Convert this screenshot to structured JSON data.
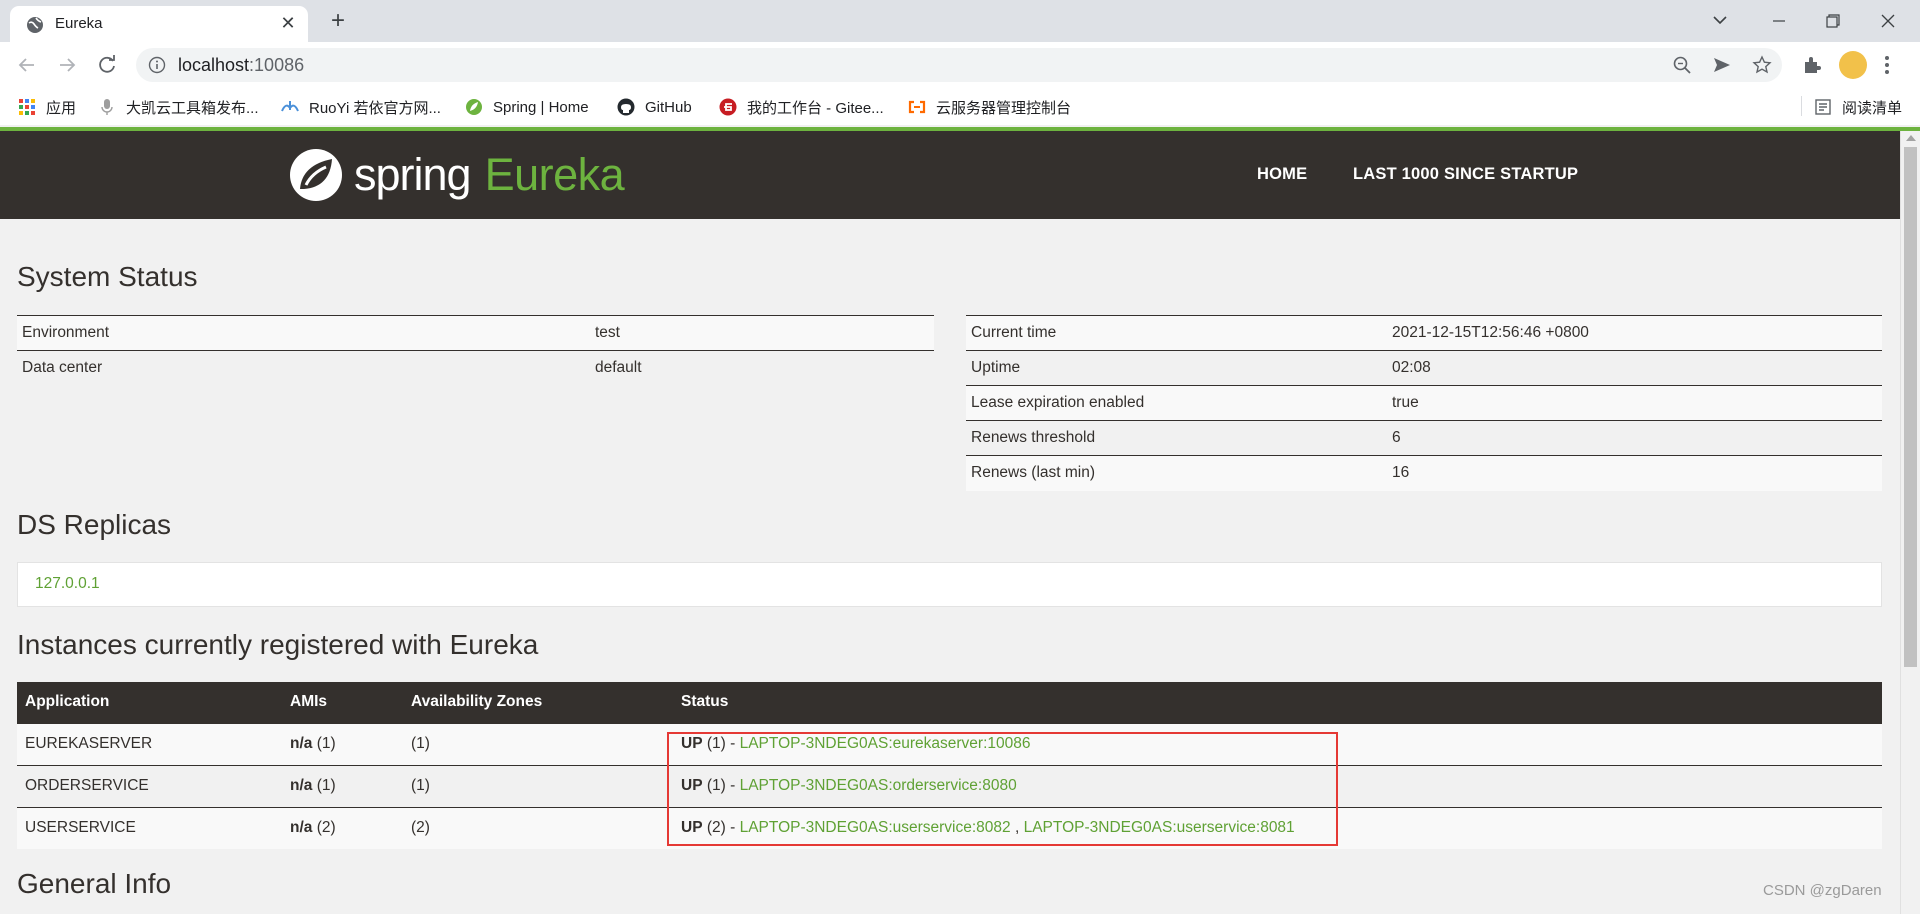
{
  "browser": {
    "tab_title": "Eureka",
    "url_host": "localhost",
    "url_port": ":10086",
    "bookmarks": [
      {
        "label": "应用",
        "icon": "apps-grid-icon"
      },
      {
        "label": "大凯云工具箱发布...",
        "icon": "mic-icon"
      },
      {
        "label": "RuoYi 若依官方网...",
        "icon": "ruoyi-icon"
      },
      {
        "label": "Spring | Home",
        "icon": "spring-leaf-icon"
      },
      {
        "label": "GitHub",
        "icon": "github-icon"
      },
      {
        "label": "我的工作台 - Gitee...",
        "icon": "gitee-icon"
      },
      {
        "label": "云服务器管理控制台",
        "icon": "aliyun-icon"
      }
    ],
    "reading_list": "阅读清单"
  },
  "header": {
    "logo_spring": "spring",
    "logo_eureka": "Eureka",
    "nav": [
      "HOME",
      "LAST 1000 SINCE STARTUP"
    ]
  },
  "system_status": {
    "title": "System Status",
    "left": [
      {
        "label": "Environment",
        "value": "test"
      },
      {
        "label": "Data center",
        "value": "default"
      }
    ],
    "right": [
      {
        "label": "Current time",
        "value": "2021-12-15T12:56:46 +0800"
      },
      {
        "label": "Uptime",
        "value": "02:08"
      },
      {
        "label": "Lease expiration enabled",
        "value": "true"
      },
      {
        "label": "Renews threshold",
        "value": "6"
      },
      {
        "label": "Renews (last min)",
        "value": "16"
      }
    ]
  },
  "ds_replicas": {
    "title": "DS Replicas",
    "items": [
      "127.0.0.1"
    ]
  },
  "instances": {
    "title": "Instances currently registered with Eureka",
    "columns": [
      "Application",
      "AMIs",
      "Availability Zones",
      "Status"
    ],
    "rows": [
      {
        "app": "EUREKASERVER",
        "ami": "n/a",
        "ami_count": " (1)",
        "zones": "(1)",
        "status": "UP",
        "status_count": " (1) - ",
        "links": [
          "LAPTOP-3NDEG0AS:eurekaserver:10086"
        ]
      },
      {
        "app": "ORDERSERVICE",
        "ami": "n/a",
        "ami_count": " (1)",
        "zones": "(1)",
        "status": "UP",
        "status_count": " (1) - ",
        "links": [
          "LAPTOP-3NDEG0AS:orderservice:8080"
        ]
      },
      {
        "app": "USERSERVICE",
        "ami": "n/a",
        "ami_count": " (2)",
        "zones": "(2)",
        "status": "UP",
        "status_count": " (2) - ",
        "links": [
          "LAPTOP-3NDEG0AS:userservice:8082",
          "LAPTOP-3NDEG0AS:userservice:8081"
        ],
        "link_sep": " , "
      }
    ]
  },
  "general_info": {
    "title": "General Info"
  },
  "watermark": "CSDN @zgDaren",
  "colors": {
    "accent_green": "#6db33f",
    "nav_dark": "#34302d",
    "highlight_red": "#e53935"
  }
}
